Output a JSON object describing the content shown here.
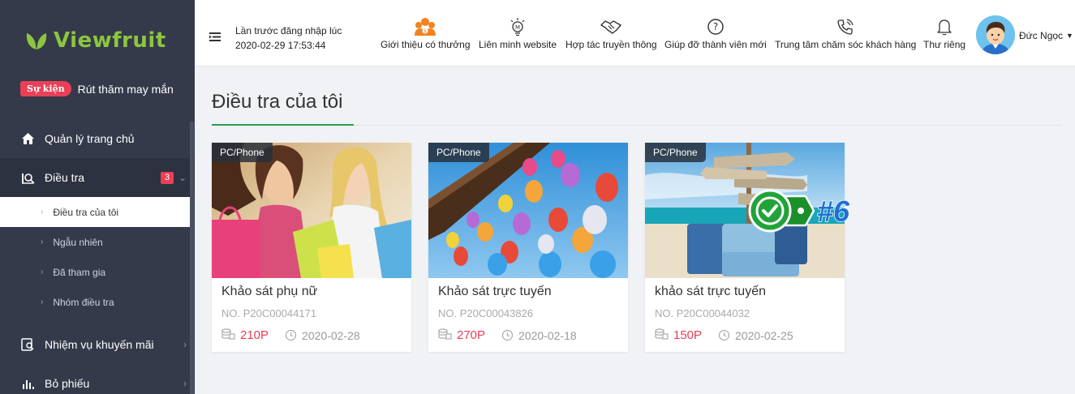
{
  "app": {
    "logo_text": "Viewfruit"
  },
  "event": {
    "badge": "Sự kiện",
    "text": "Rút thăm may mắn"
  },
  "sidebar": {
    "items": [
      {
        "label": "Quản lý trang chủ",
        "icon": "home-icon"
      },
      {
        "label": "Điều tra",
        "icon": "survey-icon",
        "badge": "3"
      },
      {
        "label": "Nhiệm vụ khuyến mãi",
        "icon": "promo-icon"
      },
      {
        "label": "Bỏ phiếu",
        "icon": "vote-icon"
      }
    ],
    "sub_items": [
      {
        "label": "Điều tra của tôi",
        "active": true
      },
      {
        "label": "Ngẫu nhiên"
      },
      {
        "label": "Đã tham gia"
      },
      {
        "label": "Nhóm điều tra"
      }
    ]
  },
  "header": {
    "login_label": "Lần trước đăng nhập lúc",
    "login_time": "2020-02-29 17:53:44",
    "links": [
      {
        "label": "Giới thiệu có thưởng",
        "icon": "referral-icon"
      },
      {
        "label": "Liên minh website",
        "icon": "lightbulb-icon"
      },
      {
        "label": "Hợp tác truyền thông",
        "icon": "handshake-icon"
      },
      {
        "label": "Giúp đỡ thành viên mới",
        "icon": "help-icon"
      },
      {
        "label": "Trung tâm chăm sóc khách hàng",
        "icon": "phone-icon"
      },
      {
        "label": "Thư riêng",
        "icon": "bell-icon"
      }
    ],
    "username": "Đức Ngọc"
  },
  "main": {
    "title": "Điều tra của tôi",
    "cards": [
      {
        "tag": "PC/Phone",
        "title": "Khảo sát phụ nữ",
        "no": "NO. P20C00044171",
        "points": "210P",
        "date": "2020-02-28"
      },
      {
        "tag": "PC/Phone",
        "title": "Khảo sát trực tuyến",
        "no": "NO. P20C00043826",
        "points": "270P",
        "date": "2020-02-18"
      },
      {
        "tag": "PC/Phone",
        "title": "khảo sát trực tuyến",
        "no": "NO. P20C00044032",
        "points": "150P",
        "date": "2020-02-25"
      }
    ]
  },
  "overlay": {
    "label": "#6"
  },
  "colors": {
    "sidebar_bg": "#343a4a",
    "accent_red": "#e94057",
    "brand_green": "#8cc63f",
    "title_accent": "#2e9c4e"
  }
}
